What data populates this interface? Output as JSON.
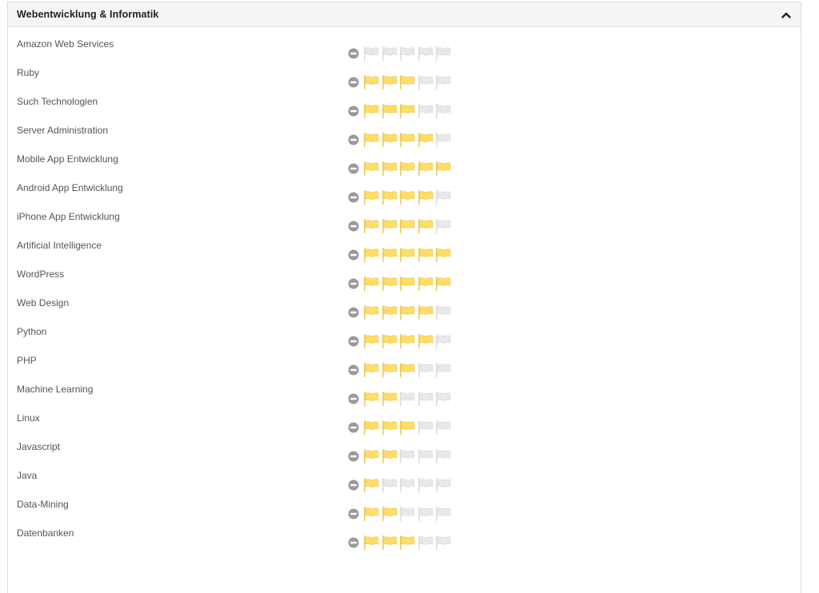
{
  "section": {
    "title": "Webentwicklung & Informatik",
    "max_level": 5,
    "colors": {
      "flag_active": "#FFDD66",
      "flag_active_stroke": "#E7C74F",
      "flag_inactive": "#E8E8E8",
      "remove_icon": "#9A9A9A"
    }
  },
  "skills": [
    {
      "name": "Amazon Web Services",
      "level": 0
    },
    {
      "name": "Ruby",
      "level": 3
    },
    {
      "name": "Such Technologien",
      "level": 3
    },
    {
      "name": "Server Administration",
      "level": 4
    },
    {
      "name": "Mobile App Entwicklung",
      "level": 5
    },
    {
      "name": "Android App Entwicklung",
      "level": 4
    },
    {
      "name": "iPhone App Entwicklung",
      "level": 4
    },
    {
      "name": "Artificial Intelligence",
      "level": 5
    },
    {
      "name": "WordPress",
      "level": 5
    },
    {
      "name": "Web Design",
      "level": 4
    },
    {
      "name": "Python",
      "level": 4
    },
    {
      "name": "PHP",
      "level": 3
    },
    {
      "name": "Machine Learning",
      "level": 2
    },
    {
      "name": "Linux",
      "level": 3
    },
    {
      "name": "Javascript",
      "level": 2
    },
    {
      "name": "Java",
      "level": 1
    },
    {
      "name": "Data-Mining",
      "level": 2
    },
    {
      "name": "Datenbanken",
      "level": 3
    }
  ]
}
